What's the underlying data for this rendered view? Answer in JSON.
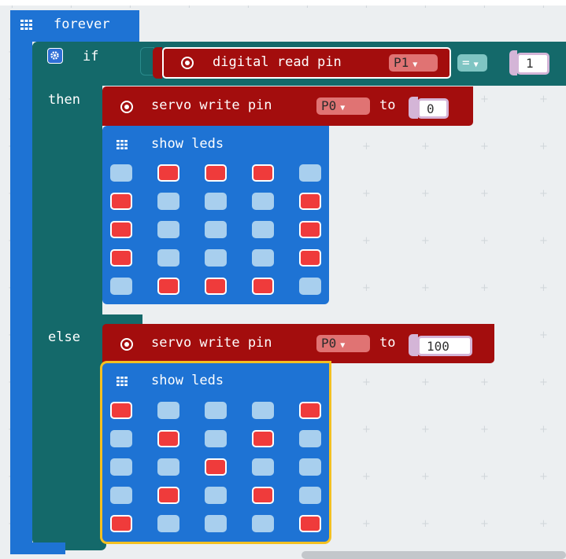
{
  "forever": {
    "label": "forever",
    "icon": "grid-icon"
  },
  "if_block": {
    "if_label": "if",
    "then_label": "then",
    "else_label": "else",
    "condition": {
      "block_label": "digital read pin",
      "pin": "P1",
      "operator": "=",
      "value": "1"
    }
  },
  "then_branch": {
    "servo": {
      "label": "servo write pin",
      "pin": "P0",
      "to_label": "to",
      "value": "0"
    },
    "leds": {
      "label": "show leds",
      "grid": [
        [
          0,
          1,
          1,
          1,
          0
        ],
        [
          1,
          0,
          0,
          0,
          1
        ],
        [
          1,
          0,
          0,
          0,
          1
        ],
        [
          1,
          0,
          0,
          0,
          1
        ],
        [
          0,
          1,
          1,
          1,
          0
        ]
      ]
    }
  },
  "else_branch": {
    "servo": {
      "label": "servo write pin",
      "pin": "P0",
      "to_label": "to",
      "value": "100"
    },
    "leds": {
      "label": "show leds",
      "selected": true,
      "grid": [
        [
          1,
          0,
          0,
          0,
          1
        ],
        [
          0,
          1,
          0,
          1,
          0
        ],
        [
          0,
          0,
          1,
          0,
          0
        ],
        [
          0,
          1,
          0,
          1,
          0
        ],
        [
          1,
          0,
          0,
          0,
          1
        ]
      ]
    }
  },
  "colors": {
    "basic": "#1e73d4",
    "logic": "#14696a",
    "pins": "#a30d0d",
    "led_on": "#ef3b3b",
    "led_off": "#a8cfee",
    "selected": "#f3c021"
  }
}
